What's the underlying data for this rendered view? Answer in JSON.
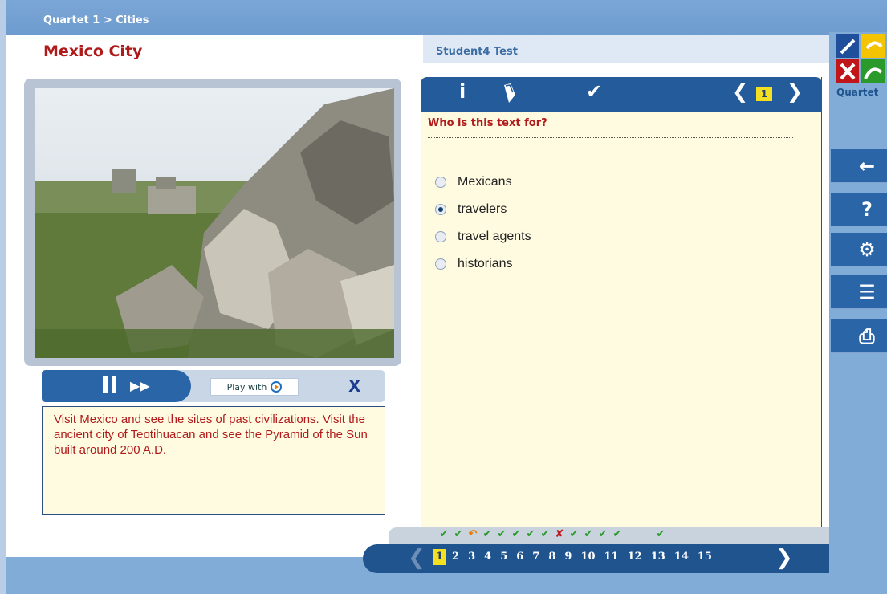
{
  "breadcrumb": "Quartet 1 > Cities",
  "page_title": "Mexico City",
  "student_label": "Student4 Test",
  "logo_text": "Quartet",
  "video": {
    "play_with_label": "Play with",
    "close_label": "X"
  },
  "passage": "Visit Mexico and see the sites of past civilizations. Visit the ancient city of Teotihuacan and see the Pyramid of the Sun built around 200 A.D.",
  "toolbar": {
    "info_icon": "info-icon",
    "eraser_icon": "eraser-icon",
    "check_icon": "check-icon",
    "page_current": "1"
  },
  "question": {
    "text": "Who is this text for?",
    "options": [
      {
        "label": "Mexicans",
        "selected": false
      },
      {
        "label": "travelers",
        "selected": true
      },
      {
        "label": "travel agents",
        "selected": false
      },
      {
        "label": "historians",
        "selected": false
      }
    ]
  },
  "progress_marks": [
    "✔",
    "✔",
    "↶",
    "✔",
    "✔",
    "✔",
    "✔",
    "✔",
    "✘",
    "✔",
    "✔",
    "✔",
    "✔",
    "",
    "✔"
  ],
  "pager": {
    "pages": [
      "1",
      "2",
      "3",
      "4",
      "5",
      "6",
      "7",
      "8",
      "9",
      "10",
      "11",
      "12",
      "13",
      "14",
      "15"
    ],
    "current": "1"
  },
  "side_buttons": [
    "back-icon",
    "help-icon",
    "settings-icon",
    "tools-icon",
    "print-icon"
  ],
  "colors": {
    "title_red": "#b01a1a",
    "toolbar_blue": "#245b9a",
    "panel_cream": "#fffbe1",
    "badge_yellow": "#f5df21",
    "check_green": "#2a9a2a",
    "cross_red": "#c0161a",
    "undo_orange": "#e07a00"
  }
}
